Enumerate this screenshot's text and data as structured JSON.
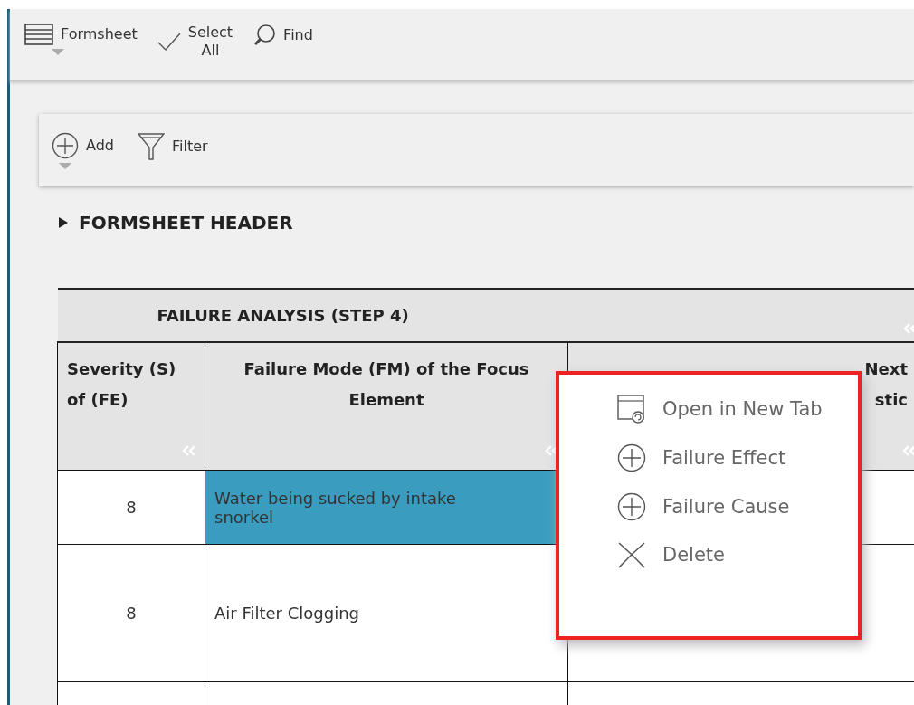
{
  "toolbar": [
    {
      "label": "Formsheet",
      "dropdown": true
    },
    {
      "label": "Select All",
      "dropdown": false
    },
    {
      "label": "Find",
      "dropdown": false
    }
  ],
  "subtoolbar": [
    {
      "label": "Add",
      "dropdown": true
    },
    {
      "label": "Filter",
      "dropdown": false
    }
  ],
  "section": {
    "title": "FORMSHEET HEADER",
    "expanded": false
  },
  "table": {
    "group_title": "FAILURE ANALYSIS (STEP 4)",
    "columns": [
      {
        "lines": [
          "Severity (S)",
          "of (FE)"
        ]
      },
      {
        "lines": [
          "Failure Mode (FM) of the Focus",
          "Element"
        ]
      },
      {
        "lines": [
          "Next",
          "stic"
        ]
      }
    ],
    "rows": [
      {
        "severity": "8",
        "failure_mode": "Water being sucked by intake snorkel",
        "selected": true
      },
      {
        "severity": "8",
        "failure_mode": "Air Filter Clogging",
        "selected": false
      }
    ]
  },
  "context_menu": {
    "items": [
      {
        "label": "Open in New Tab",
        "kind": "open-tab"
      },
      {
        "label": "Failure Effect",
        "kind": "add"
      },
      {
        "label": "Failure Cause",
        "kind": "add"
      },
      {
        "label": "Delete",
        "kind": "delete"
      }
    ]
  }
}
